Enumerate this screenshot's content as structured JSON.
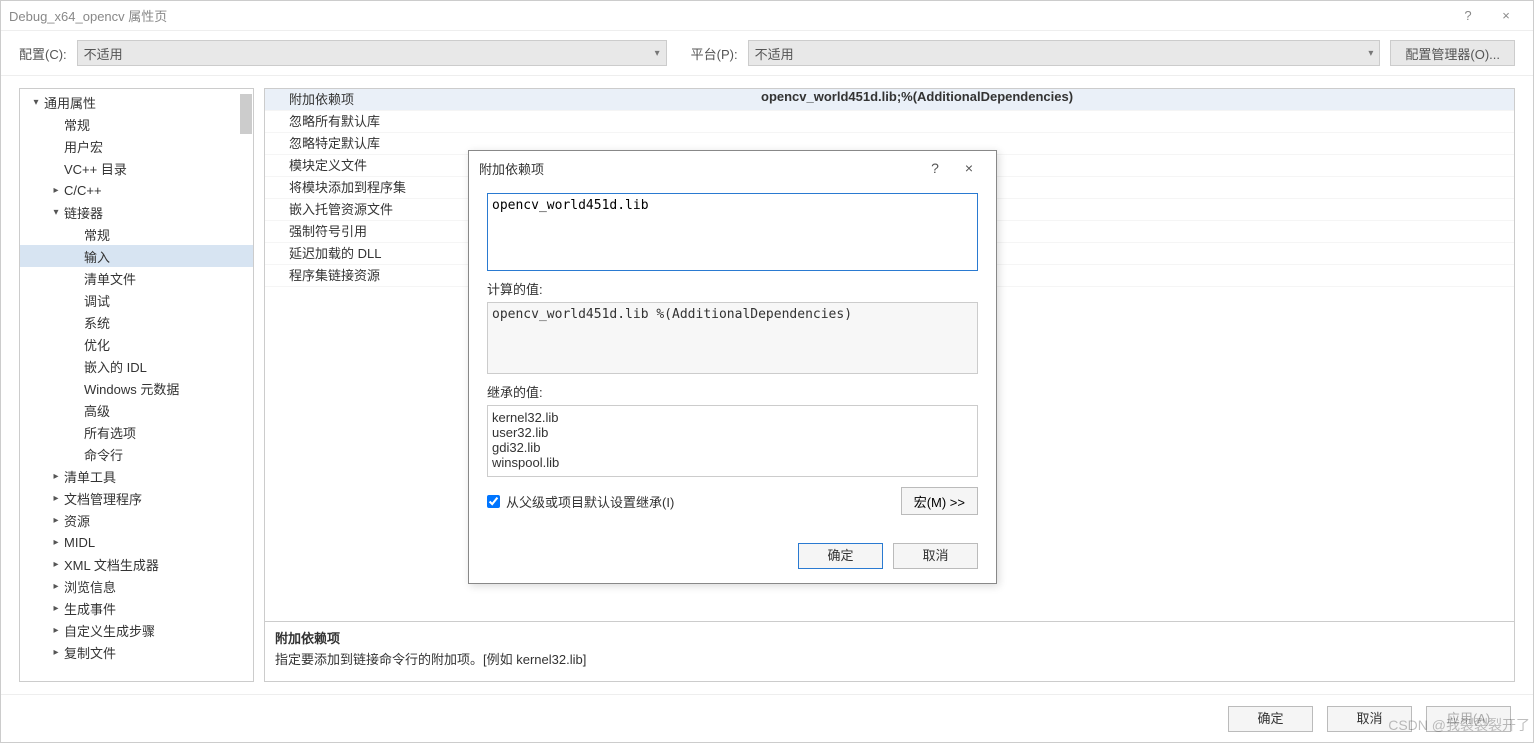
{
  "window": {
    "title": "Debug_x64_opencv 属性页",
    "help": "?",
    "close": "×"
  },
  "toolbar": {
    "config_label": "配置(C):",
    "config_value": "不适用",
    "platform_label": "平台(P):",
    "platform_value": "不适用",
    "config_manager": "配置管理器(O)..."
  },
  "tree": [
    {
      "lvl": 0,
      "caret": "▾",
      "label": "通用属性"
    },
    {
      "lvl": 1,
      "caret": "",
      "label": "常规"
    },
    {
      "lvl": 1,
      "caret": "",
      "label": "用户宏"
    },
    {
      "lvl": 1,
      "caret": "",
      "label": "VC++ 目录"
    },
    {
      "lvl": 1,
      "caret": "▸",
      "label": "C/C++"
    },
    {
      "lvl": 1,
      "caret": "▾",
      "label": "链接器"
    },
    {
      "lvl": 2,
      "caret": "",
      "label": "常规"
    },
    {
      "lvl": 2,
      "caret": "",
      "label": "输入",
      "selected": true
    },
    {
      "lvl": 2,
      "caret": "",
      "label": "清单文件"
    },
    {
      "lvl": 2,
      "caret": "",
      "label": "调试"
    },
    {
      "lvl": 2,
      "caret": "",
      "label": "系统"
    },
    {
      "lvl": 2,
      "caret": "",
      "label": "优化"
    },
    {
      "lvl": 2,
      "caret": "",
      "label": "嵌入的 IDL"
    },
    {
      "lvl": 2,
      "caret": "",
      "label": "Windows 元数据"
    },
    {
      "lvl": 2,
      "caret": "",
      "label": "高级"
    },
    {
      "lvl": 2,
      "caret": "",
      "label": "所有选项"
    },
    {
      "lvl": 2,
      "caret": "",
      "label": "命令行"
    },
    {
      "lvl": 1,
      "caret": "▸",
      "label": "清单工具"
    },
    {
      "lvl": 1,
      "caret": "▸",
      "label": "文档管理程序"
    },
    {
      "lvl": 1,
      "caret": "▸",
      "label": "资源"
    },
    {
      "lvl": 1,
      "caret": "▸",
      "label": "MIDL"
    },
    {
      "lvl": 1,
      "caret": "▸",
      "label": "XML 文档生成器"
    },
    {
      "lvl": 1,
      "caret": "▸",
      "label": "浏览信息"
    },
    {
      "lvl": 1,
      "caret": "▸",
      "label": "生成事件"
    },
    {
      "lvl": 1,
      "caret": "▸",
      "label": "自定义生成步骤"
    },
    {
      "lvl": 1,
      "caret": "▸",
      "label": "复制文件"
    }
  ],
  "grid_rows": [
    {
      "name": "附加依赖项",
      "value": "opencv_world451d.lib;%(AdditionalDependencies)",
      "sel": true
    },
    {
      "name": "忽略所有默认库",
      "value": ""
    },
    {
      "name": "忽略特定默认库",
      "value": ""
    },
    {
      "name": "模块定义文件",
      "value": ""
    },
    {
      "name": "将模块添加到程序集",
      "value": ""
    },
    {
      "name": "嵌入托管资源文件",
      "value": ""
    },
    {
      "name": "强制符号引用",
      "value": ""
    },
    {
      "name": "延迟加载的 DLL",
      "value": ""
    },
    {
      "name": "程序集链接资源",
      "value": ""
    }
  ],
  "description": {
    "title": "附加依赖项",
    "text": "指定要添加到链接命令行的附加项。[例如 kernel32.lib]"
  },
  "bottom": {
    "ok": "确定",
    "cancel": "取消",
    "apply": "应用(A)"
  },
  "dialog": {
    "title": "附加依赖项",
    "help": "?",
    "close": "×",
    "input_value": "opencv_world451d.lib",
    "computed_label": "计算的值:",
    "computed_value": "opencv_world451d.lib\n%(AdditionalDependencies)",
    "inherit_label": "继承的值:",
    "inherit_values": [
      "kernel32.lib",
      "user32.lib",
      "gdi32.lib",
      "winspool.lib"
    ],
    "checkbox_label": "从父级或项目默认设置继承(I)",
    "checkbox_checked": true,
    "macros": "宏(M) >>",
    "ok": "确定",
    "cancel": "取消"
  },
  "watermark": "CSDN @我裂裂裂开了"
}
